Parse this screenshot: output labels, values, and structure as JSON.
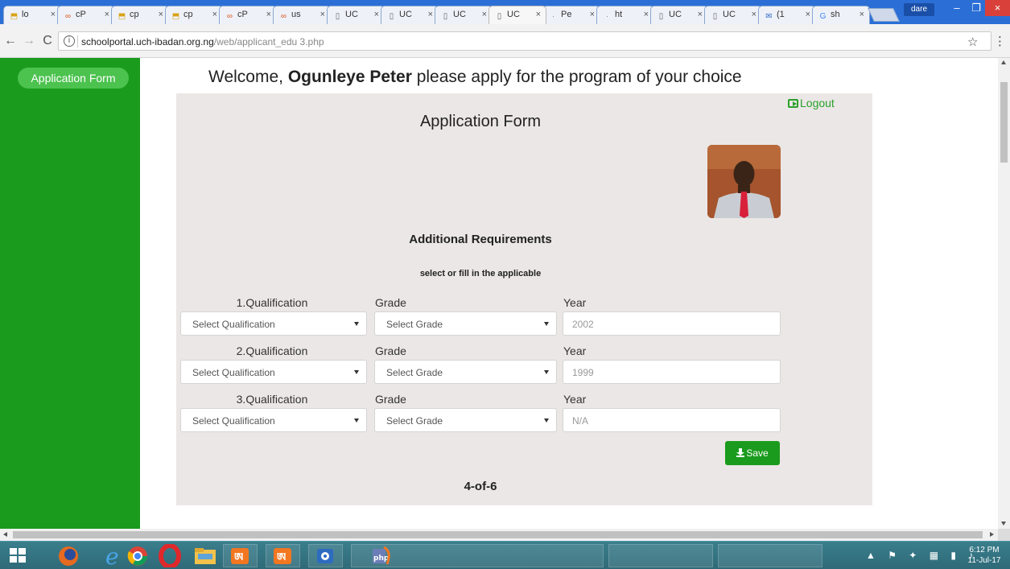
{
  "browser": {
    "tabs": [
      {
        "favicon": "paa",
        "label": "lo"
      },
      {
        "favicon": "cp",
        "label": "cP"
      },
      {
        "favicon": "paa",
        "label": "cp"
      },
      {
        "favicon": "paa",
        "label": "cp"
      },
      {
        "favicon": "cp",
        "label": "cP"
      },
      {
        "favicon": "cp",
        "label": "us"
      },
      {
        "favicon": "doc",
        "label": "UC"
      },
      {
        "favicon": "doc",
        "label": "UC"
      },
      {
        "favicon": "doc",
        "label": "UC"
      },
      {
        "favicon": "doc",
        "label": "UC"
      },
      {
        "favicon": "dot",
        "label": "Pe"
      },
      {
        "favicon": "dot",
        "label": "ht"
      },
      {
        "favicon": "doc",
        "label": "UC"
      },
      {
        "favicon": "doc",
        "label": "UC"
      },
      {
        "favicon": "mail",
        "label": "(1"
      },
      {
        "favicon": "google",
        "label": "sh"
      }
    ],
    "active_tab_index": 9,
    "tab_close_glyph": "×",
    "user_name": "dare",
    "window_buttons": {
      "minimize": "–",
      "maximize": "❐",
      "close": "×"
    },
    "url_host": "schoolportal.uch-ibadan.org.ng",
    "url_path": "/web/applicant_edu 3.php",
    "nav": {
      "back": "←",
      "forward": "→",
      "reload": "C"
    },
    "info_glyph": "i",
    "star_glyph": "☆",
    "menu_glyph": "⋮"
  },
  "sidebar": {
    "button_label": "Application Form"
  },
  "page": {
    "welcome_prefix": "Welcome, ",
    "user_name": "Ogunleye Peter",
    "welcome_suffix": " please apply for the program of your choice",
    "logout_label": "Logout",
    "form_title": "Application Form",
    "section_title": "Additional Requirements",
    "section_subtitle": "select or fill in the applicable",
    "rows": [
      {
        "qualification_label": "1.Qualification",
        "grade_label": "Grade",
        "year_label": "Year",
        "qualification_value": "Select Qualification",
        "grade_value": "Select Grade",
        "year_value": "2002"
      },
      {
        "qualification_label": "2.Qualification",
        "grade_label": "Grade",
        "year_label": "Year",
        "qualification_value": "Select Qualification",
        "grade_value": "Select Grade",
        "year_value": "1999"
      },
      {
        "qualification_label": "3.Qualification",
        "grade_label": "Grade",
        "year_label": "Year",
        "qualification_value": "Select Qualification",
        "grade_value": "Select Grade",
        "year_value": "N/A"
      }
    ],
    "save_label": "Save",
    "pager": "4-of-6"
  },
  "taskbar": {
    "clock_time": "6:12 PM",
    "clock_date": "11-Jul-17"
  },
  "colors": {
    "sidebar_green": "#1a9b1d",
    "button_green": "#4cc24f",
    "panel_bg": "#ebe7e6",
    "tabstrip_blue": "#2b6fd6"
  }
}
